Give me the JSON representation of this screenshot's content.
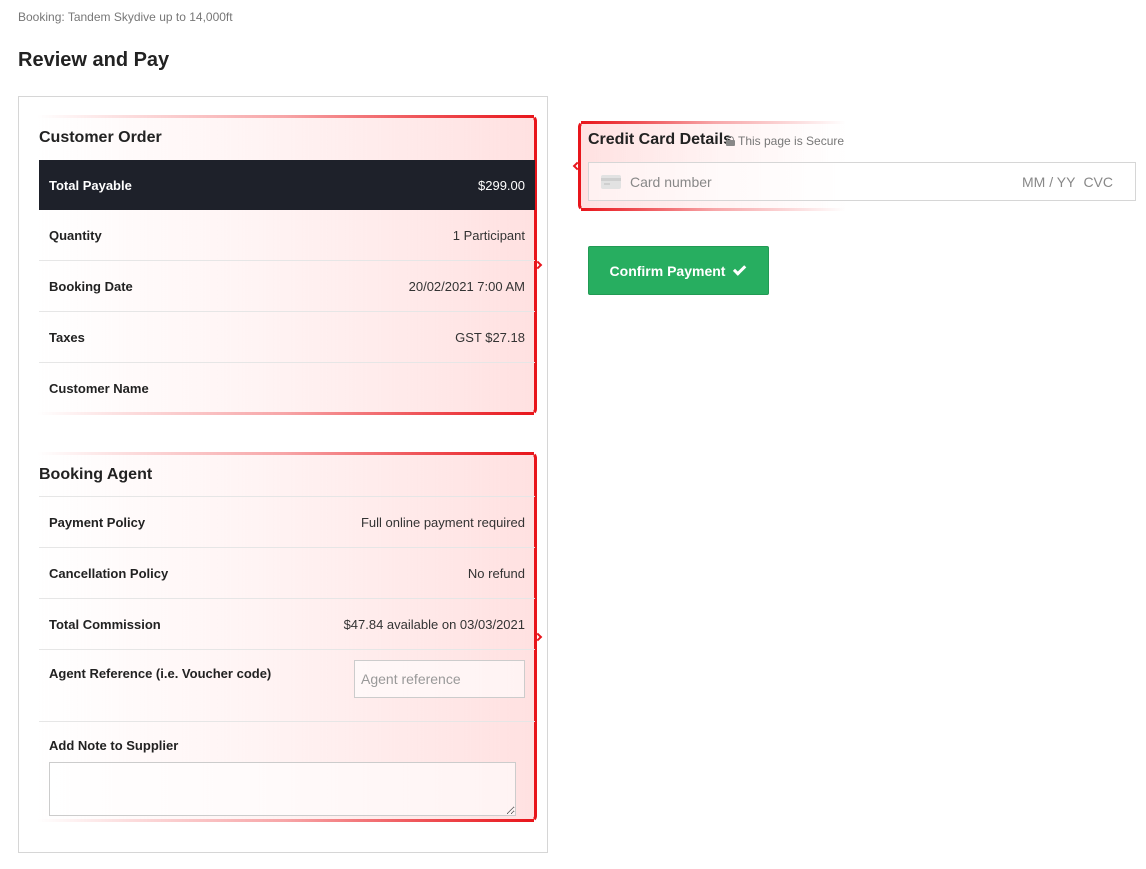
{
  "breadcrumb": "Booking: Tandem Skydive up to 14,000ft",
  "page_title": "Review and Pay",
  "customer_order": {
    "title": "Customer Order",
    "total": {
      "label": "Total Payable",
      "value": "$299.00"
    },
    "rows": [
      {
        "label": "Quantity",
        "value": "1 Participant"
      },
      {
        "label": "Booking Date",
        "value": "20/02/2021 7:00 AM"
      },
      {
        "label": "Taxes",
        "value": "GST $27.18"
      },
      {
        "label": "Customer Name",
        "value": ""
      }
    ]
  },
  "booking_agent": {
    "title": "Booking Agent",
    "rows": [
      {
        "label": "Payment Policy",
        "value": "Full online payment required"
      },
      {
        "label": "Cancellation Policy",
        "value": "No refund"
      },
      {
        "label": "Total Commission",
        "value": "$47.84 available on 03/03/2021"
      }
    ],
    "agent_reference": {
      "label": "Agent Reference (i.e. Voucher code)",
      "placeholder": "Agent reference",
      "value": ""
    },
    "note": {
      "label": "Add Note to Supplier",
      "value": ""
    }
  },
  "credit_card": {
    "title": "Credit Card Details",
    "secure_text": "This page is Secure",
    "card_placeholder": "Card number",
    "expiry_placeholder": "MM / YY",
    "cvc_placeholder": "CVC"
  },
  "confirm_button": {
    "label": "Confirm Payment"
  },
  "colors": {
    "accent_green": "#27ae60",
    "total_bar": "#1e212a",
    "highlight_red": "#e8151b"
  },
  "icons": [
    "lock-icon",
    "credit-card-icon",
    "check-icon"
  ]
}
